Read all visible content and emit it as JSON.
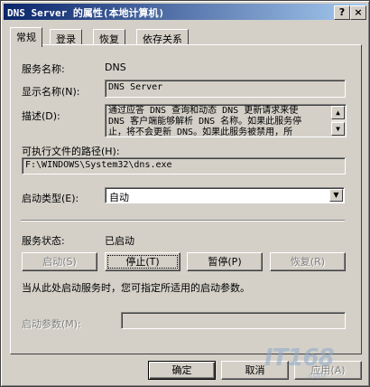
{
  "window": {
    "title": "DNS Server 的属性(本地计算机)",
    "help_glyph": "?",
    "close_glyph": "×"
  },
  "tabs": [
    {
      "label": "常规",
      "active": true
    },
    {
      "label": "登录",
      "active": false
    },
    {
      "label": "恢复",
      "active": false
    },
    {
      "label": "依存关系",
      "active": false
    }
  ],
  "general": {
    "service_name_label": "服务名称:",
    "service_name_value": "DNS",
    "display_name_label": "显示名称(N):",
    "display_name_value": "DNS Server",
    "description_label": "描述(D):",
    "description_lines": [
      "通过应答 DNS 查询和动态 DNS 更新请求来使",
      "DNS 客户端能够解析 DNS 名称。如果此服务停",
      "止，将不会更新 DNS。如果此服务被禁用，所"
    ],
    "exe_path_label": "可执行文件的路径(H):",
    "exe_path_value": "F:\\WINDOWS\\System32\\dns.exe",
    "startup_type_label": "启动类型(E):",
    "startup_type_value": "自动",
    "status_label": "服务状态:",
    "status_value": "已启动",
    "buttons": {
      "start": "启动(S)",
      "stop": "停止(T)",
      "pause": "暂停(P)",
      "resume": "恢复(R)"
    },
    "hint_text": "当从此处启动服务时，您可指定所适用的启动参数。",
    "start_params_label": "启动参数(M):",
    "start_params_value": ""
  },
  "footer": {
    "ok": "确定",
    "cancel": "取消",
    "apply": "应用(A)"
  },
  "watermark": {
    "logo_text": "IT168",
    "sub_text": ".com"
  }
}
